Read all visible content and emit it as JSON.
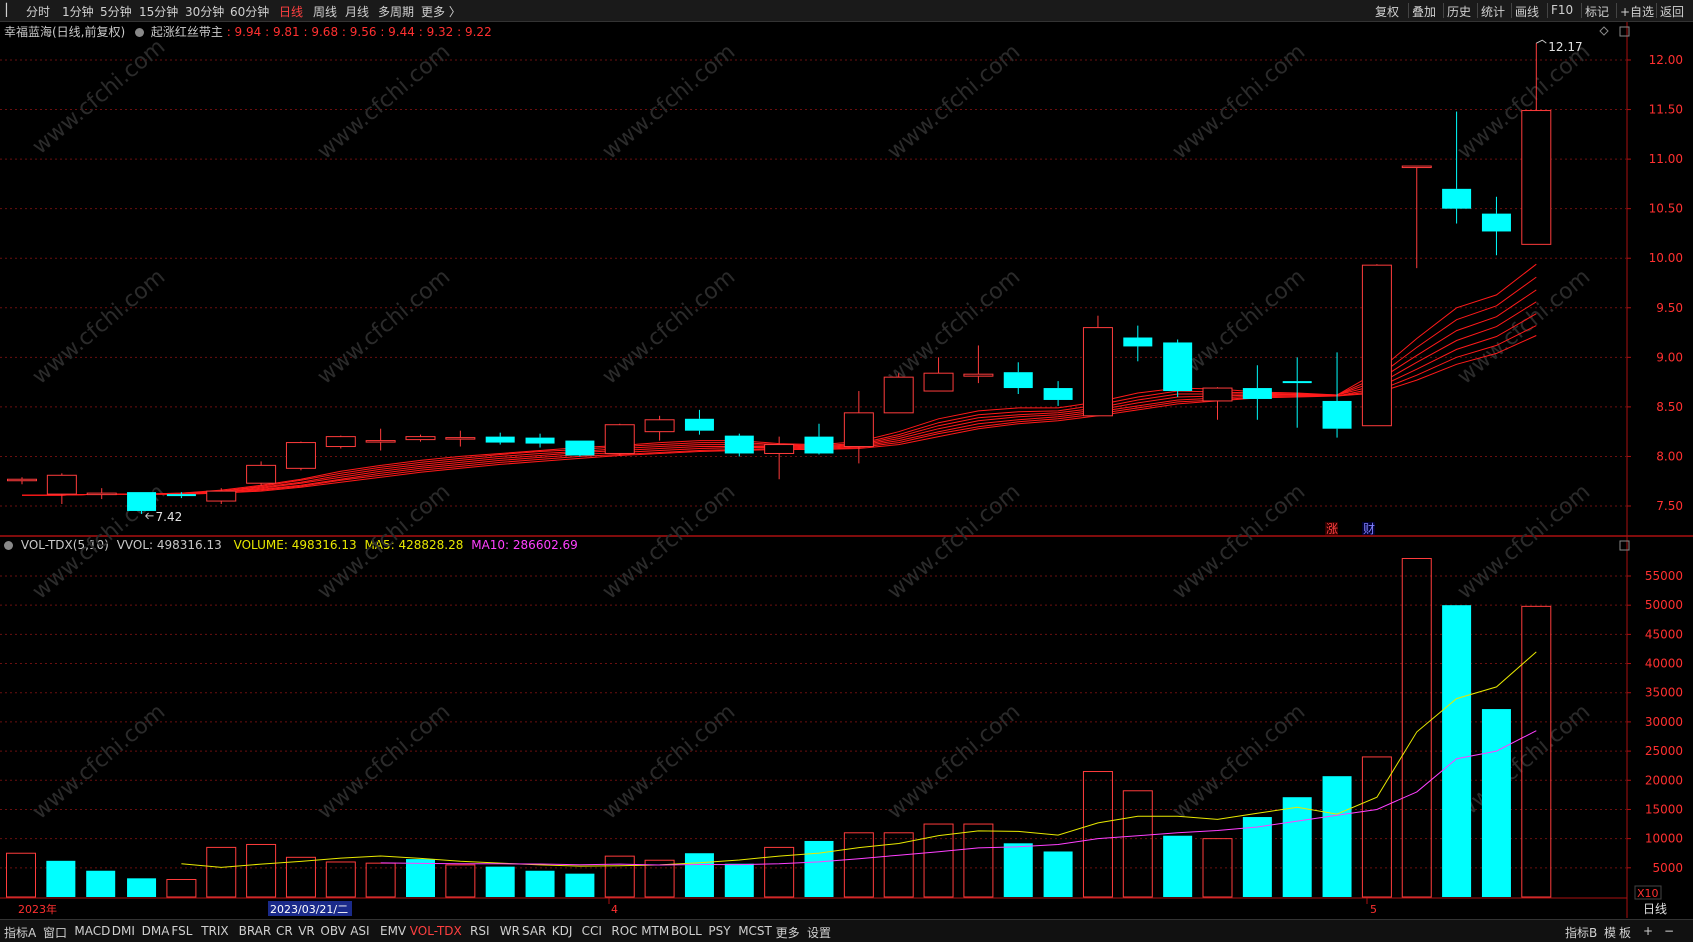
{
  "top_tabs": [
    {
      "label": "分时",
      "active": false
    },
    {
      "label": "1分钟",
      "active": false
    },
    {
      "label": "5分钟",
      "active": false
    },
    {
      "label": "15分钟",
      "active": false
    },
    {
      "label": "30分钟",
      "active": false
    },
    {
      "label": "60分钟",
      "active": false
    },
    {
      "label": "日线",
      "active": true
    },
    {
      "label": "周线",
      "active": false
    },
    {
      "label": "月线",
      "active": false
    },
    {
      "label": "多周期",
      "active": false
    },
    {
      "label": "更多",
      "active": false
    }
  ],
  "top_right": [
    "复权",
    "叠加",
    "历史",
    "统计",
    "画线",
    "F10",
    "标记",
    "+自选",
    "返回"
  ],
  "info": {
    "stock": "幸福蓝海(日线,前复权)",
    "indicator": "起涨红丝带主",
    "values": [
      ": 9.94",
      ": 9.81",
      ": 9.68",
      ": 9.56",
      ": 9.44",
      ": 9.32",
      ": 9.22"
    ]
  },
  "vol_info": {
    "name": "VOL-TDX(5,10)",
    "vvol": "VVOL: 498316.13",
    "volume": "VOLUME: 498316.13",
    "ma5": "MA5: 428828.28",
    "ma10": "MA10: 286602.69"
  },
  "markers": {
    "zhang": "涨",
    "cai": "财",
    "high": "12.17",
    "low": "7.42"
  },
  "x_labels": {
    "year": "2023年",
    "date": "2023/03/21/二",
    "m4": "4",
    "m5": "5",
    "unit": "X10"
  },
  "bottom_tabs": [
    "指标A",
    "窗口",
    "MACD",
    "DMI",
    "DMA",
    "FSL",
    "TRIX",
    "BRAR",
    "CR",
    "VR",
    "OBV",
    "ASI",
    "EMV",
    "VOL-TDX",
    "RSI",
    "WR",
    "SAR",
    "KDJ",
    "CCI",
    "ROC",
    "MTM",
    "BOLL",
    "PSY",
    "MCST",
    "更多",
    "设置"
  ],
  "bottom_active": "VOL-TDX",
  "bottom_right": [
    "指标B",
    "模",
    "板",
    "+",
    "−"
  ],
  "period_label": "日线",
  "watermark": "www.cfchi.com",
  "chart_data": [
    {
      "type": "candlestick",
      "title": "幸福蓝海(日线,前复权)",
      "ylim": [
        7.25,
        12.35
      ],
      "y_ticks": [
        7.5,
        8.0,
        8.5,
        9.0,
        9.5,
        10.0,
        10.5,
        11.0,
        11.5,
        12.0
      ],
      "candles": [
        {
          "o": 7.76,
          "h": 7.79,
          "l": 7.72,
          "c": 7.77
        },
        {
          "o": 7.62,
          "h": 7.83,
          "l": 7.52,
          "c": 7.81
        },
        {
          "o": 7.63,
          "h": 7.68,
          "l": 7.57,
          "c": 7.63
        },
        {
          "o": 7.64,
          "h": 7.64,
          "l": 7.42,
          "c": 7.45
        },
        {
          "o": 7.62,
          "h": 7.64,
          "l": 7.58,
          "c": 7.6
        },
        {
          "o": 7.55,
          "h": 7.68,
          "l": 7.52,
          "c": 7.65
        },
        {
          "o": 7.73,
          "h": 7.95,
          "l": 7.7,
          "c": 7.91
        },
        {
          "o": 7.88,
          "h": 8.15,
          "l": 7.86,
          "c": 8.14
        },
        {
          "o": 8.1,
          "h": 8.21,
          "l": 8.08,
          "c": 8.2
        },
        {
          "o": 8.16,
          "h": 8.28,
          "l": 8.06,
          "c": 8.16
        },
        {
          "o": 8.17,
          "h": 8.22,
          "l": 8.15,
          "c": 8.2
        },
        {
          "o": 8.19,
          "h": 8.26,
          "l": 8.1,
          "c": 8.19
        },
        {
          "o": 8.2,
          "h": 8.24,
          "l": 8.12,
          "c": 8.14
        },
        {
          "o": 8.19,
          "h": 8.23,
          "l": 8.09,
          "c": 8.13
        },
        {
          "o": 8.16,
          "h": 8.16,
          "l": 8.0,
          "c": 8.01
        },
        {
          "o": 8.03,
          "h": 8.33,
          "l": 8.01,
          "c": 8.32
        },
        {
          "o": 8.25,
          "h": 8.41,
          "l": 8.16,
          "c": 8.37
        },
        {
          "o": 8.38,
          "h": 8.47,
          "l": 8.22,
          "c": 8.26
        },
        {
          "o": 8.21,
          "h": 8.23,
          "l": 8.0,
          "c": 8.03
        },
        {
          "o": 8.03,
          "h": 8.2,
          "l": 7.77,
          "c": 8.12
        },
        {
          "o": 8.2,
          "h": 8.33,
          "l": 8.02,
          "c": 8.03
        },
        {
          "o": 8.1,
          "h": 8.66,
          "l": 7.93,
          "c": 8.44
        },
        {
          "o": 8.44,
          "h": 8.84,
          "l": 8.44,
          "c": 8.8
        },
        {
          "o": 8.66,
          "h": 9.0,
          "l": 8.66,
          "c": 8.84
        },
        {
          "o": 8.81,
          "h": 9.12,
          "l": 8.74,
          "c": 8.83
        },
        {
          "o": 8.85,
          "h": 8.95,
          "l": 8.63,
          "c": 8.69
        },
        {
          "o": 8.69,
          "h": 8.76,
          "l": 8.51,
          "c": 8.57
        },
        {
          "o": 8.41,
          "h": 9.42,
          "l": 8.41,
          "c": 9.3
        },
        {
          "o": 9.2,
          "h": 9.32,
          "l": 8.96,
          "c": 9.11
        },
        {
          "o": 9.15,
          "h": 9.18,
          "l": 8.6,
          "c": 8.66
        },
        {
          "o": 8.56,
          "h": 8.7,
          "l": 8.37,
          "c": 8.69
        },
        {
          "o": 8.69,
          "h": 8.92,
          "l": 8.37,
          "c": 8.58
        },
        {
          "o": 8.76,
          "h": 9.0,
          "l": 8.29,
          "c": 8.74
        },
        {
          "o": 8.56,
          "h": 9.05,
          "l": 8.19,
          "c": 8.28
        },
        {
          "o": 8.31,
          "h": 9.94,
          "l": 8.31,
          "c": 9.93
        },
        {
          "o": 10.93,
          "h": 10.93,
          "l": 9.9,
          "c": 10.93
        },
        {
          "o": 10.7,
          "h": 11.48,
          "l": 10.35,
          "c": 10.5
        },
        {
          "o": 10.45,
          "h": 10.62,
          "l": 10.03,
          "c": 10.27
        },
        {
          "o": 10.14,
          "h": 12.17,
          "l": 10.14,
          "c": 11.49
        }
      ],
      "ribbon": {
        "note": "起涨红丝带主 (7 lines)",
        "lines": [
          [
            7.61,
            7.61,
            7.62,
            7.62,
            7.63,
            7.66,
            7.71,
            7.77,
            7.85,
            7.91,
            7.96,
            8.0,
            8.03,
            8.06,
            8.09,
            8.11,
            8.14,
            8.16,
            8.16,
            8.13,
            8.12,
            8.15,
            8.25,
            8.38,
            8.46,
            8.49,
            8.49,
            8.55,
            8.64,
            8.69,
            8.68,
            8.65,
            8.64,
            8.62,
            8.85,
            9.19,
            9.5,
            9.63,
            9.94
          ],
          [
            7.61,
            7.61,
            7.62,
            7.62,
            7.63,
            7.65,
            7.7,
            7.76,
            7.83,
            7.89,
            7.94,
            7.98,
            8.02,
            8.05,
            8.07,
            8.1,
            8.12,
            8.14,
            8.14,
            8.12,
            8.11,
            8.13,
            8.22,
            8.34,
            8.42,
            8.45,
            8.46,
            8.52,
            8.6,
            8.66,
            8.65,
            8.64,
            8.63,
            8.62,
            8.8,
            9.1,
            9.38,
            9.52,
            9.81
          ],
          [
            7.61,
            7.61,
            7.62,
            7.62,
            7.62,
            7.65,
            7.69,
            7.74,
            7.81,
            7.87,
            7.92,
            7.96,
            8.0,
            8.03,
            8.05,
            8.08,
            8.1,
            8.12,
            8.12,
            8.11,
            8.1,
            8.12,
            8.2,
            8.31,
            8.39,
            8.42,
            8.44,
            8.49,
            8.57,
            8.63,
            8.63,
            8.63,
            8.63,
            8.62,
            8.76,
            9.02,
            9.27,
            9.41,
            9.68
          ],
          [
            7.61,
            7.61,
            7.62,
            7.62,
            7.62,
            7.64,
            7.68,
            7.73,
            7.79,
            7.85,
            7.9,
            7.94,
            7.98,
            8.01,
            8.04,
            8.06,
            8.08,
            8.1,
            8.1,
            8.1,
            8.09,
            8.11,
            8.18,
            8.28,
            8.36,
            8.4,
            8.42,
            8.47,
            8.54,
            8.6,
            8.61,
            8.62,
            8.62,
            8.62,
            8.72,
            8.95,
            9.17,
            9.31,
            9.56
          ],
          [
            7.61,
            7.61,
            7.62,
            7.62,
            7.62,
            7.64,
            7.67,
            7.71,
            7.77,
            7.83,
            7.88,
            7.92,
            7.96,
            7.99,
            8.02,
            8.04,
            8.06,
            8.08,
            8.09,
            8.09,
            8.08,
            8.1,
            8.16,
            8.25,
            8.33,
            8.37,
            8.4,
            8.45,
            8.51,
            8.57,
            8.59,
            8.61,
            8.62,
            8.61,
            8.69,
            8.88,
            9.08,
            9.21,
            9.44
          ],
          [
            7.61,
            7.61,
            7.62,
            7.62,
            7.62,
            7.63,
            7.66,
            7.7,
            7.76,
            7.81,
            7.86,
            7.9,
            7.94,
            7.97,
            8.0,
            8.02,
            8.04,
            8.06,
            8.07,
            8.08,
            8.07,
            8.09,
            8.14,
            8.23,
            8.3,
            8.35,
            8.38,
            8.43,
            8.49,
            8.55,
            8.57,
            8.6,
            8.61,
            8.61,
            8.66,
            8.82,
            9.0,
            9.12,
            9.32
          ],
          [
            7.61,
            7.61,
            7.62,
            7.62,
            7.62,
            7.63,
            7.65,
            7.69,
            7.74,
            7.79,
            7.84,
            7.88,
            7.92,
            7.95,
            7.98,
            8.01,
            8.03,
            8.05,
            8.06,
            8.07,
            8.07,
            8.08,
            8.12,
            8.2,
            8.28,
            8.33,
            8.36,
            8.41,
            8.47,
            8.53,
            8.56,
            8.59,
            8.6,
            8.61,
            8.64,
            8.77,
            8.93,
            9.04,
            9.22
          ]
        ]
      }
    },
    {
      "type": "bar",
      "title": "VOL-TDX(5,10)",
      "unit": "X10",
      "ylim": [
        0,
        60000
      ],
      "y_ticks": [
        5000,
        10000,
        15000,
        20000,
        25000,
        30000,
        35000,
        40000,
        45000,
        50000,
        55000
      ],
      "values": [
        7500,
        6200,
        4500,
        3200,
        3000,
        8500,
        9000,
        6800,
        6000,
        5800,
        6500,
        5500,
        5200,
        4500,
        4000,
        7000,
        6300,
        7500,
        5700,
        8500,
        9600,
        11000,
        11000,
        12500,
        12500,
        9200,
        7800,
        21500,
        18200,
        10500,
        10000,
        13700,
        17100,
        20700,
        24000,
        58000,
        50000,
        32200,
        49800
      ],
      "up": [
        true,
        false,
        false,
        false,
        true,
        true,
        true,
        true,
        true,
        true,
        false,
        true,
        false,
        false,
        false,
        true,
        true,
        false,
        false,
        true,
        false,
        true,
        true,
        true,
        true,
        false,
        false,
        true,
        true,
        false,
        true,
        false,
        false,
        false,
        true,
        true,
        false,
        false,
        true
      ],
      "ma5": [
        null,
        null,
        null,
        null,
        5680,
        5080,
        5640,
        6100,
        6660,
        7020,
        6620,
        6120,
        5800,
        5500,
        5300,
        5340,
        5500,
        5860,
        6340,
        7000,
        7520,
        8460,
        9160,
        10520,
        11320,
        11240,
        10600,
        12700,
        13840,
        13840,
        13300,
        14340,
        15380,
        14200,
        17100,
        28280,
        34000,
        36000,
        42000
      ],
      "ma10": [
        null,
        null,
        null,
        null,
        null,
        null,
        null,
        null,
        null,
        5850,
        5750,
        5680,
        5680,
        5660,
        5530,
        5640,
        5490,
        5570,
        5550,
        5700,
        6010,
        6560,
        7160,
        7750,
        8420,
        8600,
        9000,
        10000,
        10500,
        11000,
        11400,
        12000,
        13000,
        14000,
        15000,
        18000,
        23700,
        25000,
        28500
      ]
    }
  ]
}
